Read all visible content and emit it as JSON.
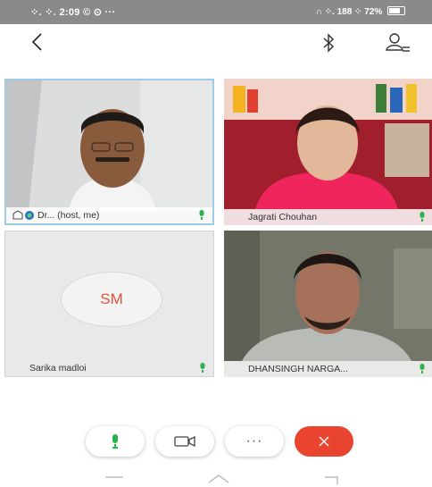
{
  "status_bar": {
    "left_text": "⁘. ⁘. 2:09  © ⊙ ···",
    "right_text": "∩ ⁘. 188  ⁘ 72%"
  },
  "participants": [
    {
      "name": "Dr...  (host, me)"
    },
    {
      "name": "Jagrati Chouhan"
    },
    {
      "name": "Sarika madloi",
      "initials": "SM"
    },
    {
      "name": "DHANSINGH NARGA..."
    }
  ],
  "controls": {
    "more_label": "···"
  },
  "colors": {
    "end_call": "#e8442f",
    "mic_active": "#2bb24a",
    "avatar_text": "#e0513a"
  }
}
